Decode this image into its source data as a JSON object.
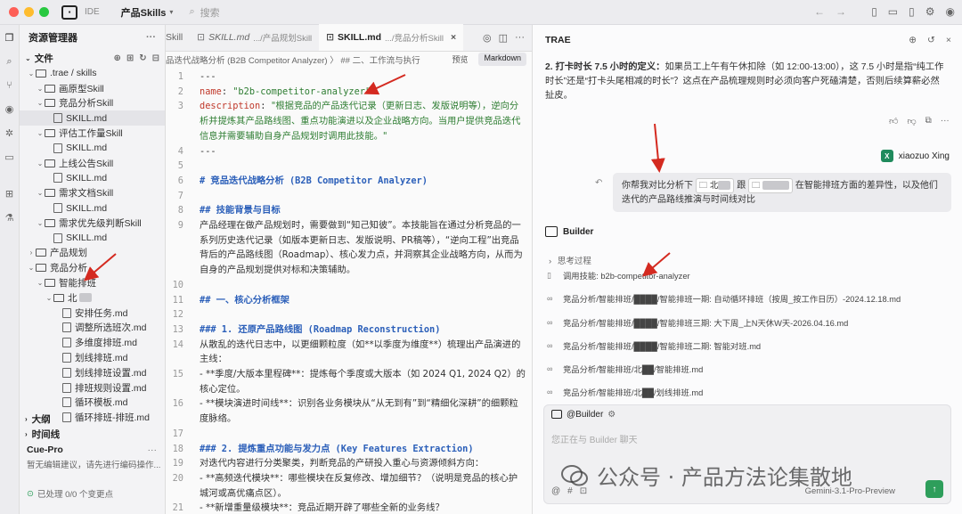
{
  "titlebar": {
    "ide_label": "IDE",
    "project": "产品Skills",
    "search_placeholder": "搜索"
  },
  "explorer": {
    "title": "资源管理器",
    "files_label": "文件",
    "tree": [
      {
        "label": ".trae / skills",
        "indent": 0,
        "kind": "folder",
        "open": true
      },
      {
        "label": "画原型Skill",
        "indent": 1,
        "kind": "folder",
        "open": true
      },
      {
        "label": "竞品分析Skill",
        "indent": 1,
        "kind": "folder",
        "open": true
      },
      {
        "label": "SKILL.md",
        "indent": 2,
        "kind": "file",
        "selected": true
      },
      {
        "label": "评估工作量Skill",
        "indent": 1,
        "kind": "folder",
        "open": true
      },
      {
        "label": "SKILL.md",
        "indent": 2,
        "kind": "file"
      },
      {
        "label": "上线公告Skill",
        "indent": 1,
        "kind": "folder",
        "open": true
      },
      {
        "label": "SKILL.md",
        "indent": 2,
        "kind": "file"
      },
      {
        "label": "需求文档Skill",
        "indent": 1,
        "kind": "folder",
        "open": true
      },
      {
        "label": "SKILL.md",
        "indent": 2,
        "kind": "file"
      },
      {
        "label": "需求优先级判断Skill",
        "indent": 1,
        "kind": "folder",
        "open": true
      },
      {
        "label": "SKILL.md",
        "indent": 2,
        "kind": "file"
      },
      {
        "label": "产品规划",
        "indent": 0,
        "kind": "folder",
        "open": false
      },
      {
        "label": "竞品分析",
        "indent": 0,
        "kind": "folder",
        "open": true
      },
      {
        "label": "智能排班",
        "indent": 1,
        "kind": "folder",
        "open": true
      },
      {
        "label": "北",
        "indent": 2,
        "kind": "folder",
        "open": true
      },
      {
        "label": "安排任务.md",
        "indent": 3,
        "kind": "file"
      },
      {
        "label": "调整所选班次.md",
        "indent": 3,
        "kind": "file"
      },
      {
        "label": "多维度排班.md",
        "indent": 3,
        "kind": "file"
      },
      {
        "label": "划线排班.md",
        "indent": 3,
        "kind": "file"
      },
      {
        "label": "划线排班设置.md",
        "indent": 3,
        "kind": "file"
      },
      {
        "label": "排班规则设置.md",
        "indent": 3,
        "kind": "file"
      },
      {
        "label": "循环模板.md",
        "indent": 3,
        "kind": "file"
      },
      {
        "label": "循环排班-排班.md",
        "indent": 3,
        "kind": "file"
      }
    ],
    "outline_label": "大纲",
    "timeline_label": "时间线",
    "cue_label": "Cue-Pro",
    "cue_message": "暂无编辑建议，请先进行编码操作...",
    "status": "已处理 0/0 个变更点"
  },
  "editor": {
    "tabs": [
      {
        "name": "Skill",
        "path": ""
      },
      {
        "name": "SKILL.md",
        "path": ".../产品规划Skill"
      },
      {
        "name": "SKILL.md",
        "path": ".../竞品分析Skill",
        "active": true
      }
    ],
    "breadcrumb": "品迭代战略分析 (B2B Competitor Analyzer)  〉 ## 二、工作流与执行",
    "preview_label": "预览",
    "markdown_label": "Markdown",
    "lines": [
      {
        "n": "1",
        "html": "---"
      },
      {
        "n": "2",
        "html": "<span class='k'>name</span>: <span class='s'>\"b2b-competitor-analyzer\"</span>"
      },
      {
        "n": "3",
        "html": "<span class='k'>description</span>: <span class='s cjk'>\"根据竞品的产品迭代记录（更新日志、发版说明等），逆向分析并提炼其产品路线图、重点功能演进以及企业战略方向。当用户提供竞品迭代信息并需要辅助自身产品规划时调用此技能。\"</span>"
      },
      {
        "n": "4",
        "html": "---"
      },
      {
        "n": "5",
        "html": ""
      },
      {
        "n": "6",
        "html": "<span class='h'># 竞品迭代战略分析 (B2B Competitor Analyzer)</span>"
      },
      {
        "n": "7",
        "html": ""
      },
      {
        "n": "8",
        "html": "<span class='h'>## 技能背景与目标</span>"
      },
      {
        "n": "9",
        "html": "<span class='cjk'>产品经理在做产品规划时，需要做到“知己知彼”。本技能旨在通过分析竞品的一系列历史迭代记录（如版本更新日志、发版说明、PR稿等），“逆向工程”出竞品背后的产品路线图（Roadmap）、核心发力点，并洞察其企业战略方向，从而为自身的产品规划提供对标和决策辅助。</span>"
      },
      {
        "n": "10",
        "html": ""
      },
      {
        "n": "11",
        "html": "<span class='h'>## 一、核心分析框架</span>"
      },
      {
        "n": "12",
        "html": ""
      },
      {
        "n": "13",
        "html": "<span class='h'>### 1. 还原产品路线图 (Roadmap Reconstruction)</span>"
      },
      {
        "n": "14",
        "html": "<span class='cjk'>从散乱的迭代日志中，以更细颗粒度（如**以季度为维度**）梳理出产品演进的主线：</span>"
      },
      {
        "n": "15",
        "html": "<span class='cjk'>- **季度/大版本里程碑**：提炼每个季度或大版本（如 2024 Q1, 2024 Q2）的核心定位。</span>"
      },
      {
        "n": "16",
        "html": "<span class='cjk'>- **模块演进时间线**：识别各业务模块从“从无到有”到“精细化深耕”的细颗粒度脉络。</span>"
      },
      {
        "n": "17",
        "html": ""
      },
      {
        "n": "18",
        "html": "<span class='h'>### 2. 提炼重点功能与发力点 (Key Features Extraction)</span>"
      },
      {
        "n": "19",
        "html": "<span class='cjk'>对迭代内容进行分类聚类，判断竞品的产研投入重心与资源倾斜方向：</span>"
      },
      {
        "n": "20",
        "html": "<span class='cjk'>- **高频迭代模块**：哪些模块在反复修改、增加细节？（说明是竞品的核心护城河或高优痛点区）。</span>"
      },
      {
        "n": "21",
        "html": "<span class='cjk'>- **新增重量级模块**：竞品近期开辟了哪些全新的业务线？</span>"
      }
    ]
  },
  "chat": {
    "title": "TRAE",
    "paragraph": "<span class='num'>2. 打卡时长 7.5 小时的定义：</span>如果员工上午有午休扣除（如 12:00-13:00），这 7.5 小时是指“纯工作时长”还是“打卡头尾相减的时长”？这点在产品梳理规则时必须向客户死磕清楚，否则后续算薪必然扯皮。",
    "user_name": "xiaozuo Xing",
    "user_initial": "X",
    "user_message_1": "你帮我对比分析下",
    "user_chip_1": "北",
    "user_message_and": "跟",
    "user_message_2": "在智能排班方面的差异性，以及他们迭代的产品路线推演与时间线对比",
    "agent_name": "Builder",
    "thinking": "思考过程",
    "steps": [
      {
        "icon": "book-icon",
        "text": "调用技能: b2b-competitor-analyzer"
      },
      {
        "icon": "link-icon",
        "text": "竞品分析/智能排班/████/智能排班一期: 自动循环排班（按周_按工作日历）-2024.12.18.md"
      },
      {
        "icon": "link-icon",
        "text": "竞品分析/智能排班/████/智能排班三期: 大下周_上N天休W天-2026.04.16.md"
      },
      {
        "icon": "link-icon",
        "text": "竞品分析/智能排班/████/智能排班二期: 智能对班.md"
      },
      {
        "icon": "link-icon",
        "text": "竞品分析/智能排班/北██/智能排班.md"
      },
      {
        "icon": "link-icon",
        "text": "竞品分析/智能排班/北██/划线排班.md"
      }
    ],
    "composer_agent": "@Builder",
    "composer_placeholder": "您正在与 Builder 聊天",
    "model": "Gemini-3.1-Pro-Preview",
    "watermark": "公众号 · 产品方法论集散地"
  },
  "colors": {
    "accent_green": "#2e9e5b",
    "arrow_red": "#d42a20",
    "keyword_red": "#c0392b",
    "string_green": "#2e7d32",
    "heading_blue": "#2b5fb9"
  }
}
